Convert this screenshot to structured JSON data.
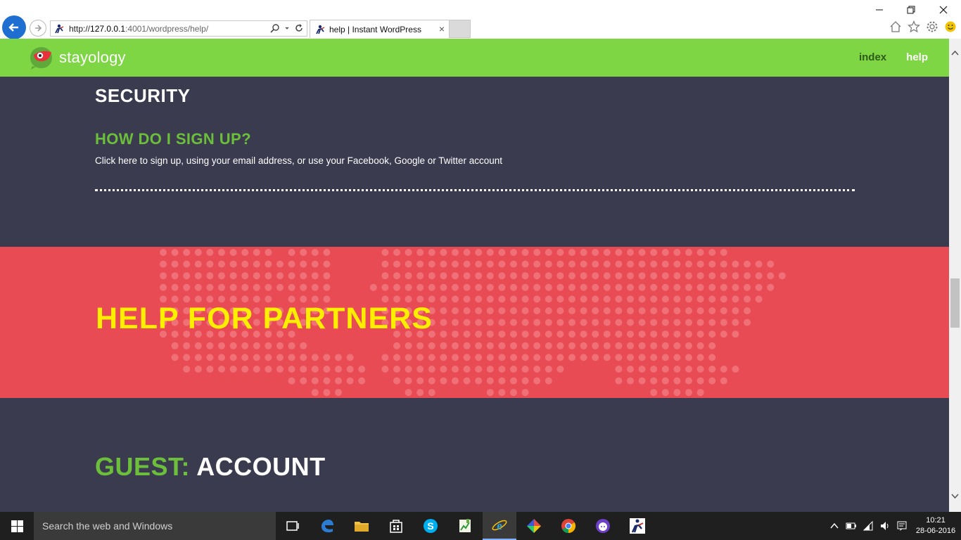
{
  "browser": {
    "url_prefix": "http://",
    "url_host": "127.0.0.1",
    "url_path": ":4001/wordpress/help/",
    "tab_title": "help | Instant WordPress",
    "tab_close": "×"
  },
  "site": {
    "logo_text": "stayology",
    "nav": {
      "index": "index",
      "help": "help"
    },
    "section_title": "SECURITY",
    "faq_question": "HOW DO I SIGN UP?",
    "faq_answer": "Click here to sign up, using your email address, or use your Facebook, Google or Twitter account",
    "band_title": "HELP FOR PARTNERS",
    "guest_label": "GUEST:",
    "guest_section": "ACCOUNT"
  },
  "colors": {
    "header_green": "#7ed645",
    "page_bg": "#3a3b4f",
    "band_red": "#e94b55",
    "band_title_yellow": "#ffee00",
    "heading_green": "#6cbf3a"
  },
  "taskbar": {
    "search_placeholder": "Search the web and Windows",
    "time": "10:21",
    "date": "28-06-2016"
  }
}
